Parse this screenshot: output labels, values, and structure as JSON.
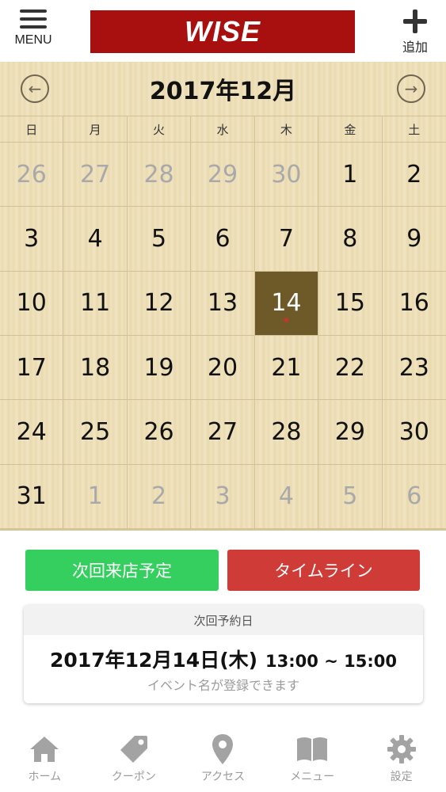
{
  "header": {
    "menu_label": "MENU",
    "logo_text": "WISE",
    "add_label": "追加"
  },
  "calendar": {
    "title": "2017年12月",
    "weekdays": [
      "日",
      "月",
      "火",
      "水",
      "木",
      "金",
      "土"
    ],
    "weeks": [
      [
        {
          "d": "26",
          "other": true
        },
        {
          "d": "27",
          "other": true
        },
        {
          "d": "28",
          "other": true
        },
        {
          "d": "29",
          "other": true
        },
        {
          "d": "30",
          "other": true
        },
        {
          "d": "1"
        },
        {
          "d": "2"
        }
      ],
      [
        {
          "d": "3"
        },
        {
          "d": "4"
        },
        {
          "d": "5"
        },
        {
          "d": "6"
        },
        {
          "d": "7"
        },
        {
          "d": "8"
        },
        {
          "d": "9"
        }
      ],
      [
        {
          "d": "10"
        },
        {
          "d": "11"
        },
        {
          "d": "12"
        },
        {
          "d": "13"
        },
        {
          "d": "14",
          "selected": true,
          "star": true
        },
        {
          "d": "15"
        },
        {
          "d": "16"
        }
      ],
      [
        {
          "d": "17"
        },
        {
          "d": "18"
        },
        {
          "d": "19"
        },
        {
          "d": "20"
        },
        {
          "d": "21"
        },
        {
          "d": "22"
        },
        {
          "d": "23"
        }
      ],
      [
        {
          "d": "24"
        },
        {
          "d": "25"
        },
        {
          "d": "26"
        },
        {
          "d": "27"
        },
        {
          "d": "28"
        },
        {
          "d": "29"
        },
        {
          "d": "30"
        }
      ],
      [
        {
          "d": "31"
        },
        {
          "d": "1",
          "other": true
        },
        {
          "d": "2",
          "other": true
        },
        {
          "d": "3",
          "other": true
        },
        {
          "d": "4",
          "other": true
        },
        {
          "d": "5",
          "other": true
        },
        {
          "d": "6",
          "other": true
        }
      ]
    ]
  },
  "actions": {
    "next_visit_label": "次回来店予定",
    "timeline_label": "タイムライン"
  },
  "reservation": {
    "heading": "次回予約日",
    "date": "2017年12月14日(木)",
    "time": "13:00 ~ 15:00",
    "event_placeholder": "イベント名が登録できます"
  },
  "tabbar": [
    {
      "label": "ホーム",
      "icon": "home-icon"
    },
    {
      "label": "クーポン",
      "icon": "tag-icon"
    },
    {
      "label": "アクセス",
      "icon": "map-pin-icon"
    },
    {
      "label": "メニュー",
      "icon": "book-icon"
    },
    {
      "label": "設定",
      "icon": "gear-icon"
    }
  ],
  "colors": {
    "brand_red": "#a8100f",
    "selected_day": "#6d5a28",
    "green_button": "#35cf5f",
    "red_button": "#cf3b37"
  }
}
